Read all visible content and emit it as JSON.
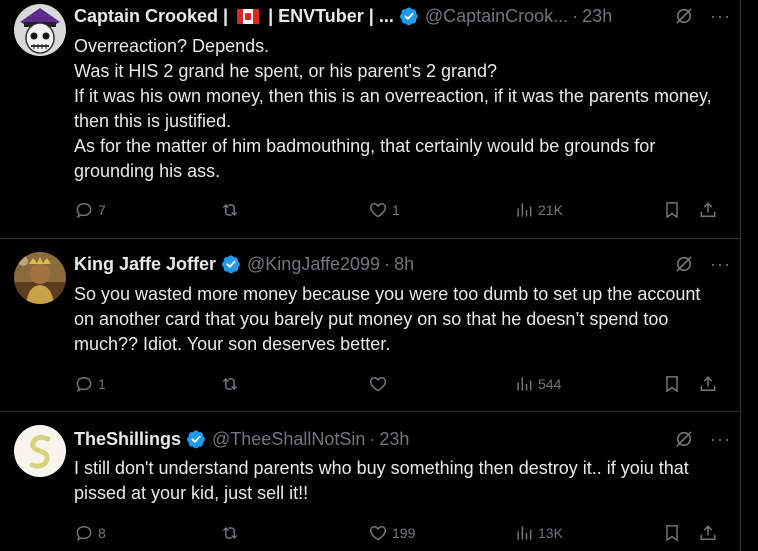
{
  "tweets": [
    {
      "name": "Captain Crooked | ",
      "name_suffix": " | ENVTuber | ...",
      "handle": "@CaptainCrook...",
      "dot": "·",
      "time": "23h",
      "lines": [
        "Overreaction? Depends.",
        "Was it HIS 2 grand he spent, or his parent's 2 grand?",
        "If it was his own money, then this is an overreaction, if it was the parents money, then this is justified.",
        "As for the matter of him badmouthing, that certainly would be grounds for grounding his ass."
      ],
      "replies": "7",
      "reposts": "",
      "likes": "1",
      "views": "21K"
    },
    {
      "name": "King Jaffe Joffer",
      "handle": "@KingJaffe2099",
      "dot": "·",
      "time": "8h",
      "lines": [
        "So you wasted more money because you were too dumb to set up the account on another card that you barely put money on so that he doesn’t spend too much?? Idiot. Your son deserves better."
      ],
      "replies": "1",
      "reposts": "",
      "likes": "",
      "views": "544"
    },
    {
      "name": "TheShillings",
      "handle": "@TheeShallNotSin",
      "dot": "·",
      "time": "23h",
      "lines": [
        "I still don't understand parents who buy something then destroy it.. if yoiu that pissed at your kid, just sell it!!"
      ],
      "replies": "8",
      "reposts": "",
      "likes": "199",
      "views": "13K"
    }
  ],
  "more_glyph": "···",
  "colors": {
    "verified": "#1d9bf0",
    "muted": "#71767b",
    "text": "#e7e9ea",
    "divider": "#2f3336"
  }
}
